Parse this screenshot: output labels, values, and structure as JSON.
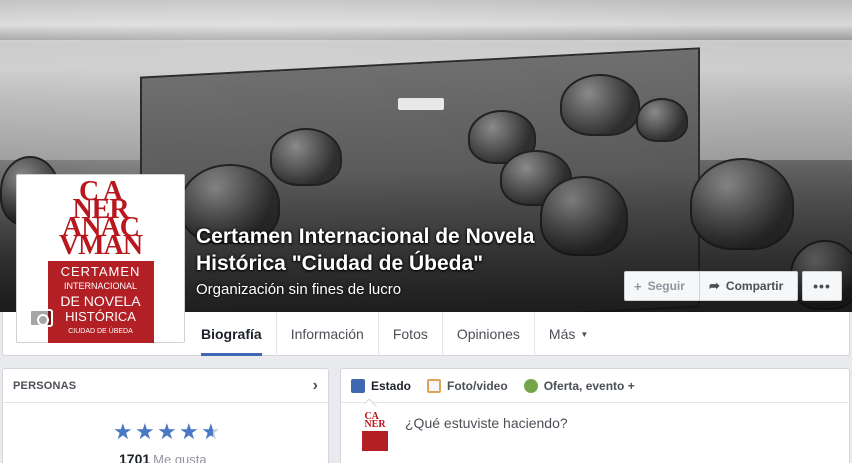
{
  "cover": {
    "page_name_line1": "Certamen Internacional de Novela",
    "page_name_line2": "Histórica \"Ciudad de Úbeda\"",
    "category": "Organización sin fines de lucro"
  },
  "profile_logo": {
    "top_letters": "CA NER ANAC VMAN",
    "line1": "CERTAMEN",
    "line2": "INTERNACIONAL",
    "line3": "DE NOVELA",
    "line4": "HISTÓRICA",
    "line5": "CIUDAD DE ÚBEDA"
  },
  "cover_actions": {
    "follow": "Seguir",
    "share": "Compartir",
    "more": "•••"
  },
  "tabs": [
    {
      "label": "Biografía",
      "active": true
    },
    {
      "label": "Información"
    },
    {
      "label": "Fotos"
    },
    {
      "label": "Opiniones"
    },
    {
      "label": "Más"
    }
  ],
  "people_card": {
    "title": "PERSONAS",
    "rating": 4.5,
    "likes_count": "1701",
    "likes_label": "Me gusta"
  },
  "composer": {
    "tabs": [
      {
        "label": "Estado",
        "icon": "pencil-icon"
      },
      {
        "label": "Foto/video",
        "icon": "photo-icon"
      },
      {
        "label": "Oferta, evento +",
        "icon": "offer-icon"
      }
    ],
    "placeholder": "¿Qué estuviste haciendo?"
  },
  "colors": {
    "brand_red": "#b21f25",
    "facebook_blue": "#4267b2"
  }
}
